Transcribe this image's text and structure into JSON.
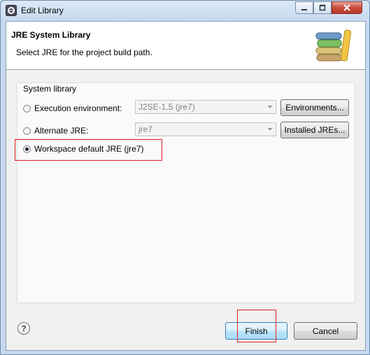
{
  "window": {
    "title": "Edit Library",
    "buttons": {
      "minimize": "minimize-icon",
      "maximize": "maximize-icon",
      "close": "close-icon"
    }
  },
  "header": {
    "title": "JRE System Library",
    "description": "Select JRE for the project build path.",
    "icon": "library-books-icon"
  },
  "group": {
    "label": "System library",
    "options": [
      {
        "label": "Execution environment:",
        "selected": false,
        "combo_value": "J2SE-1.5 (jre7)",
        "combo_enabled": false,
        "button": "Environments..."
      },
      {
        "label": "Alternate JRE:",
        "selected": false,
        "combo_value": "jre7",
        "combo_enabled": false,
        "button": "Installed JREs..."
      },
      {
        "label": "Workspace default JRE (jre7)",
        "selected": true
      }
    ]
  },
  "footer": {
    "help_icon": "help-icon",
    "finish_label": "Finish",
    "cancel_label": "Cancel"
  },
  "colors": {
    "highlight_box": "#e02020",
    "default_button": "#3c7fb1",
    "title_bar": "#c7d9ee"
  }
}
